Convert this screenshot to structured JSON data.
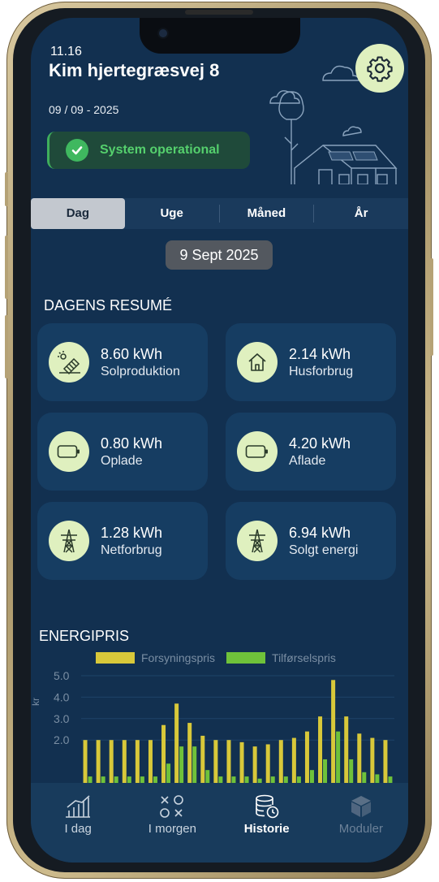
{
  "status_bar": {
    "time": "11.16"
  },
  "header": {
    "address": "Kim hjertegræsvej 8",
    "date": "09 / 09 - 2025",
    "status_text": "System operational"
  },
  "tabs": [
    {
      "label": "Dag",
      "active": true
    },
    {
      "label": "Uge",
      "active": false
    },
    {
      "label": "Måned",
      "active": false
    },
    {
      "label": "År",
      "active": false
    }
  ],
  "selected_date": "9 Sept 2025",
  "summary": {
    "title": "DAGENS RESUMÉ",
    "cards": [
      {
        "value": "8.60 kWh",
        "label": "Solproduktion",
        "icon": "solar-panel-icon"
      },
      {
        "value": "2.14 kWh",
        "label": "Husforbrug",
        "icon": "house-icon"
      },
      {
        "value": "0.80 kWh",
        "label": "Oplade",
        "icon": "battery-icon"
      },
      {
        "value": "4.20 kWh",
        "label": "Aflade",
        "icon": "battery-icon"
      },
      {
        "value": "1.28 kWh",
        "label": "Netforbrug",
        "icon": "power-tower-icon"
      },
      {
        "value": "6.94 kWh",
        "label": "Solgt energi",
        "icon": "power-tower-icon"
      }
    ]
  },
  "energy_price": {
    "title": "ENERGIPRIS"
  },
  "chart_data": {
    "type": "bar",
    "title": "",
    "xlabel": "",
    "ylabel": "kr",
    "ylim": [
      0,
      5.0
    ],
    "yticks": [
      "5.0",
      "4.0",
      "3.0",
      "2.0"
    ],
    "legend_position": "top",
    "series": [
      {
        "name": "Forsyningspris",
        "color": "#d8c83a",
        "values": [
          2.0,
          2.0,
          2.0,
          2.0,
          2.0,
          2.0,
          2.7,
          3.7,
          2.8,
          2.2,
          2.0,
          2.0,
          1.9,
          1.7,
          1.8,
          2.0,
          2.1,
          2.4,
          3.1,
          4.8,
          3.1,
          2.3,
          2.1,
          2.0
        ]
      },
      {
        "name": "Tilførselspris",
        "color": "#6fc23a",
        "values": [
          0.3,
          0.3,
          0.3,
          0.3,
          0.3,
          0.3,
          0.9,
          1.7,
          1.7,
          0.6,
          0.3,
          0.3,
          0.3,
          0.2,
          0.3,
          0.3,
          0.3,
          0.6,
          1.1,
          2.4,
          1.1,
          0.5,
          0.4,
          0.3
        ]
      }
    ]
  },
  "bottom_nav": [
    {
      "label": "I dag",
      "icon": "chart-bars-icon",
      "state": "normal"
    },
    {
      "label": "I morgen",
      "icon": "tic-tac-toe-icon",
      "state": "normal"
    },
    {
      "label": "Historie",
      "icon": "database-clock-icon",
      "state": "active"
    },
    {
      "label": "Moduler",
      "icon": "cube-icon",
      "state": "disabled"
    }
  ]
}
